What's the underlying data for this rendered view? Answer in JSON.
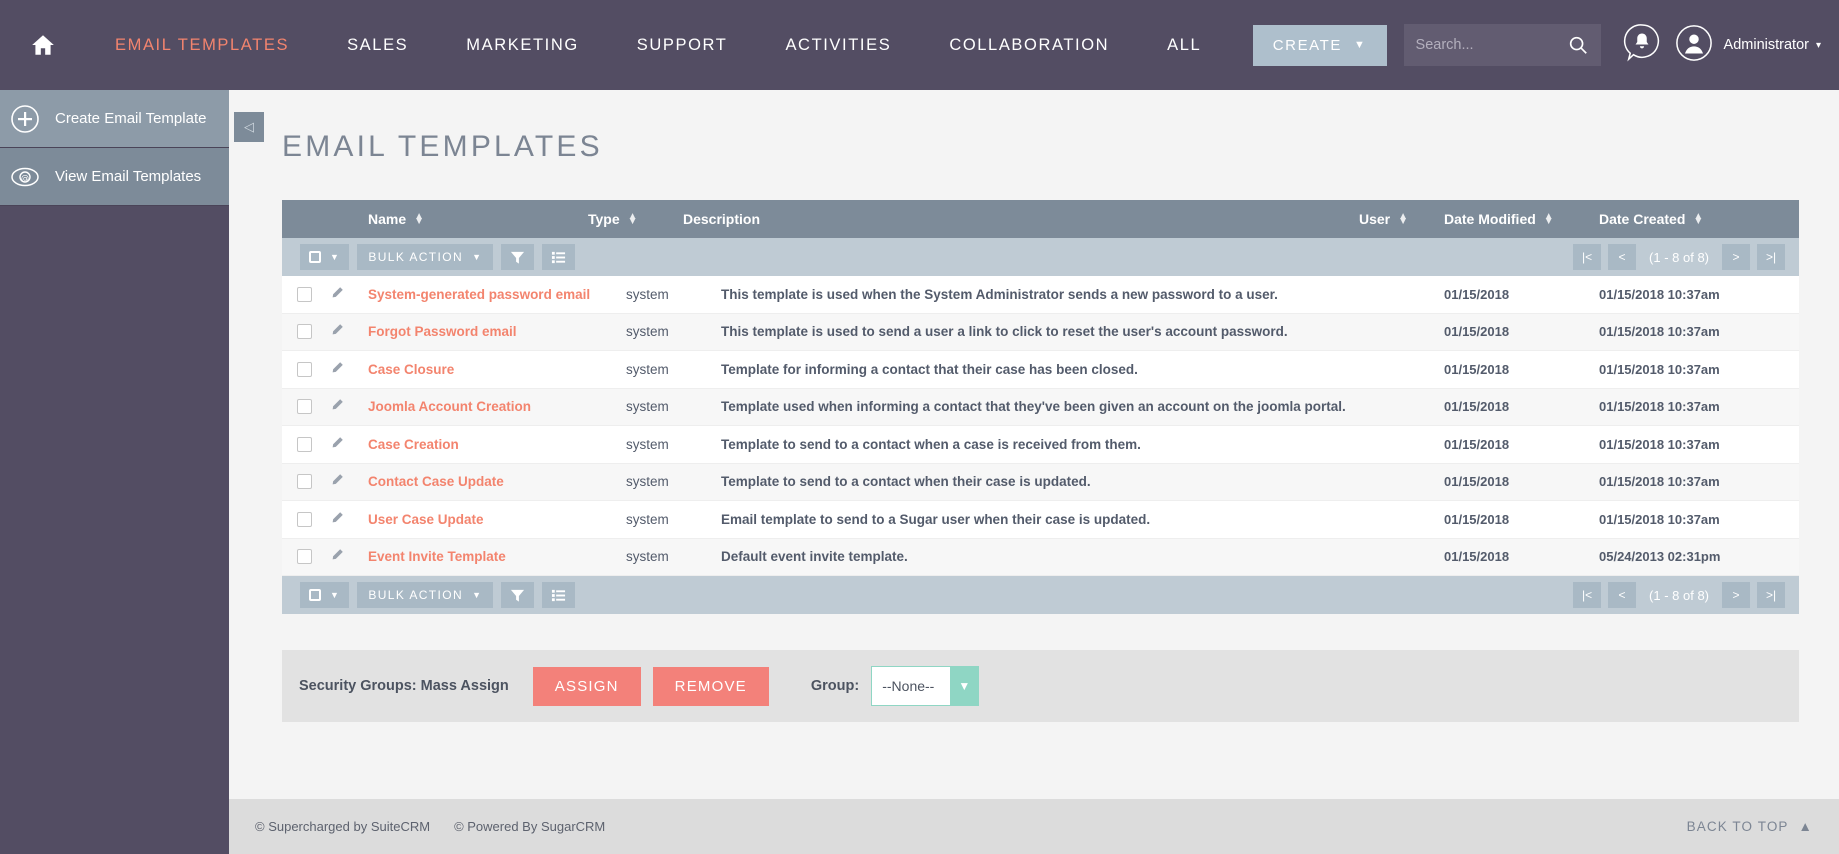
{
  "header": {
    "home_icon": "home-icon",
    "nav": [
      {
        "label": "EMAIL TEMPLATES",
        "active": true
      },
      {
        "label": "SALES",
        "active": false
      },
      {
        "label": "MARKETING",
        "active": false
      },
      {
        "label": "SUPPORT",
        "active": false
      },
      {
        "label": "ACTIVITIES",
        "active": false
      },
      {
        "label": "COLLABORATION",
        "active": false
      },
      {
        "label": "ALL",
        "active": false
      }
    ],
    "create_label": "CREATE",
    "create_caret": "▼",
    "search_placeholder": "Search...",
    "search_value": "",
    "search_icon": "search-icon",
    "bell_icon": "notification-bell-icon",
    "avatar_icon": "user-avatar-icon",
    "user_label": "Administrator",
    "user_caret": "▾",
    "accent": "#f3846e",
    "nav_bg": "#534d63"
  },
  "sidebar": {
    "items": [
      {
        "label": "Create Email Template",
        "icon": "plus-circle-icon"
      },
      {
        "label": "View Email Templates",
        "icon": "eye-at-icon"
      }
    ],
    "collapse_icon": "◁"
  },
  "main": {
    "page_title": "EMAIL TEMPLATES"
  },
  "table": {
    "columns": [
      {
        "key": "name",
        "label": "Name",
        "sortable": true
      },
      {
        "key": "type",
        "label": "Type",
        "sortable": true
      },
      {
        "key": "description",
        "label": "Description",
        "sortable": false
      },
      {
        "key": "user",
        "label": "User",
        "sortable": true
      },
      {
        "key": "date_modified",
        "label": "Date Modified",
        "sortable": true
      },
      {
        "key": "date_created",
        "label": "Date Created",
        "sortable": true
      }
    ],
    "sort_glyph_up": "▲",
    "sort_glyph_down": "▼",
    "rows": [
      {
        "name": "System-generated password email",
        "type": "system",
        "description": "This template is used when the System Administrator sends a new password to a user.",
        "user": "",
        "date_modified": "01/15/2018",
        "date_created": "01/15/2018 10:37am"
      },
      {
        "name": "Forgot Password email",
        "type": "system",
        "description": "This template is used to send a user a link to click to reset the user's account password.",
        "user": "",
        "date_modified": "01/15/2018",
        "date_created": "01/15/2018 10:37am"
      },
      {
        "name": "Case Closure",
        "type": "system",
        "description": "Template for informing a contact that their case has been closed.",
        "user": "",
        "date_modified": "01/15/2018",
        "date_created": "01/15/2018 10:37am"
      },
      {
        "name": "Joomla Account Creation",
        "type": "system",
        "description": "Template used when informing a contact that they've been given an account on the joomla portal.",
        "user": "",
        "date_modified": "01/15/2018",
        "date_created": "01/15/2018 10:37am"
      },
      {
        "name": "Case Creation",
        "type": "system",
        "description": "Template to send to a contact when a case is received from them.",
        "user": "",
        "date_modified": "01/15/2018",
        "date_created": "01/15/2018 10:37am"
      },
      {
        "name": "Contact Case Update",
        "type": "system",
        "description": "Template to send to a contact when their case is updated.",
        "user": "",
        "date_modified": "01/15/2018",
        "date_created": "01/15/2018 10:37am"
      },
      {
        "name": "User Case Update",
        "type": "system",
        "description": "Email template to send to a Sugar user when their case is updated.",
        "user": "",
        "date_modified": "01/15/2018",
        "date_created": "01/15/2018 10:37am"
      },
      {
        "name": "Event Invite Template",
        "type": "system",
        "description": "Default event invite template.",
        "user": "",
        "date_modified": "01/15/2018",
        "date_created": "05/24/2013 02:31pm"
      }
    ]
  },
  "toolbar": {
    "select_all_caret": "▼",
    "bulk_action_label": "BULK ACTION",
    "bulk_action_caret": "▼",
    "filter_icon": "funnel-filter-icon",
    "columns_icon": "column-chooser-icon",
    "pager": {
      "first": "|<",
      "prev": "<",
      "count": "(1 - 8 of 8)",
      "next": ">",
      "last": ">|"
    }
  },
  "security_groups": {
    "title": "Security Groups: Mass Assign",
    "assign_label": "ASSIGN",
    "remove_label": "REMOVE",
    "group_label": "Group:",
    "group_value": "--None--",
    "group_caret": "▼",
    "button_color": "#f3817a",
    "select_accent": "#8fd6c4"
  },
  "footer": {
    "copyright_suite": "© Supercharged by SuiteCRM",
    "copyright_sugar": "© Powered By SugarCRM",
    "back_to_top": "BACK TO TOP",
    "back_to_top_icon": "▲"
  }
}
